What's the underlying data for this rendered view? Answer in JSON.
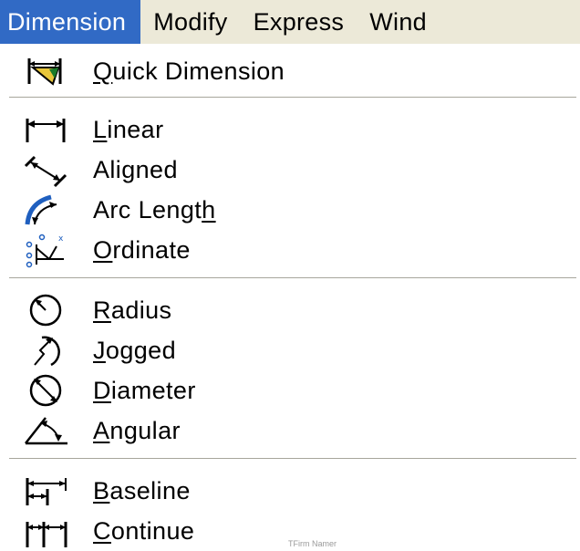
{
  "menubar": {
    "items": [
      "Dimension",
      "Modify",
      "Express",
      "Wind"
    ]
  },
  "menu": {
    "items": [
      {
        "pre": "",
        "ul": "Q",
        "post": "uick Dimension",
        "icon": "quick-dimension-icon"
      },
      {
        "pre": "",
        "ul": "L",
        "post": "inear",
        "icon": "linear-dimension-icon"
      },
      {
        "pre": "Aligned",
        "ul": "",
        "post": "",
        "icon": "aligned-dimension-icon"
      },
      {
        "pre": "Arc Lengt",
        "ul": "h",
        "post": "",
        "icon": "arc-length-icon"
      },
      {
        "pre": "",
        "ul": "O",
        "post": "rdinate",
        "icon": "ordinate-icon"
      },
      {
        "pre": "",
        "ul": "R",
        "post": "adius",
        "icon": "radius-icon"
      },
      {
        "pre": "",
        "ul": "J",
        "post": "ogged",
        "icon": "jogged-icon"
      },
      {
        "pre": "",
        "ul": "D",
        "post": "iameter",
        "icon": "diameter-icon"
      },
      {
        "pre": "",
        "ul": "A",
        "post": "ngular",
        "icon": "angular-icon"
      },
      {
        "pre": "",
        "ul": "B",
        "post": "aseline",
        "icon": "baseline-icon"
      },
      {
        "pre": "",
        "ul": "C",
        "post": "ontinue",
        "icon": "continue-icon"
      }
    ]
  },
  "watermark": "TFirm Namer"
}
